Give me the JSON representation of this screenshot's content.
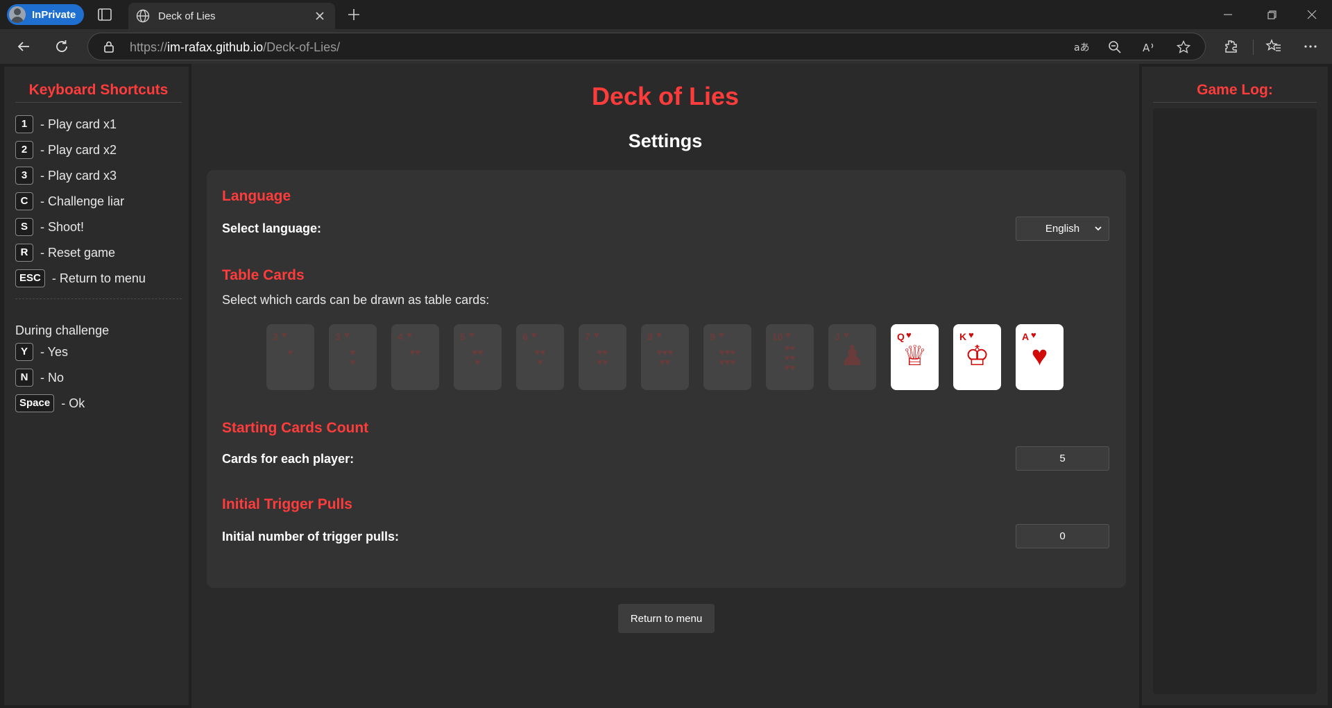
{
  "browser": {
    "profile_label": "InPrivate",
    "tab_title": "Deck of Lies",
    "url_prefix": "https://",
    "url_host": "im-rafax.github.io",
    "url_path": "/Deck-of-Lies/"
  },
  "shortcuts": {
    "title": "Keyboard Shortcuts",
    "items": [
      {
        "key": "1",
        "label": "- Play card x1"
      },
      {
        "key": "2",
        "label": "- Play card x2"
      },
      {
        "key": "3",
        "label": "- Play card x3"
      },
      {
        "key": "C",
        "label": "- Challenge liar"
      },
      {
        "key": "S",
        "label": "- Shoot!"
      },
      {
        "key": "R",
        "label": "- Reset game"
      },
      {
        "key": "ESC",
        "label": "- Return to menu"
      }
    ],
    "during_label": "During challenge",
    "challenge_items": [
      {
        "key": "Y",
        "label": "- Yes"
      },
      {
        "key": "N",
        "label": "- No"
      },
      {
        "key": "Space",
        "label": "- Ok"
      }
    ]
  },
  "main": {
    "game_title": "Deck of Lies",
    "settings_title": "Settings",
    "language": {
      "section": "Language",
      "label": "Select language:",
      "selected": "English"
    },
    "table_cards": {
      "section": "Table Cards",
      "description": "Select which cards can be drawn as table cards:",
      "cards": [
        {
          "rank": "2",
          "suit": "♥",
          "pips": "♥",
          "selected": false
        },
        {
          "rank": "3",
          "suit": "♥",
          "pips": "♥\n♥",
          "selected": false
        },
        {
          "rank": "4",
          "suit": "♥",
          "pips": "♥♥",
          "selected": false
        },
        {
          "rank": "5",
          "suit": "♥",
          "pips": "♥♥\n♥",
          "selected": false
        },
        {
          "rank": "6",
          "suit": "♥",
          "pips": "♥♥\n♥",
          "selected": false
        },
        {
          "rank": "7",
          "suit": "♥",
          "pips": "♥♥\n♥♥",
          "selected": false
        },
        {
          "rank": "8",
          "suit": "♥",
          "pips": "♥♥♥\n♥♥",
          "selected": false
        },
        {
          "rank": "9",
          "suit": "♥",
          "pips": "♥♥♥\n♥♥♥",
          "selected": false
        },
        {
          "rank": "10",
          "suit": "♥",
          "pips": "♥♥\n♥♥\n♥♥",
          "selected": false
        },
        {
          "rank": "J",
          "suit": "♥",
          "pips": "♟",
          "selected": false
        },
        {
          "rank": "Q",
          "suit": "♥",
          "pips": "♕",
          "selected": true
        },
        {
          "rank": "K",
          "suit": "♥",
          "pips": "♔",
          "selected": true
        },
        {
          "rank": "A",
          "suit": "♥",
          "pips": "♥",
          "selected": true
        }
      ]
    },
    "starting_cards": {
      "section": "Starting Cards Count",
      "label": "Cards for each player:",
      "value": "5"
    },
    "trigger_pulls": {
      "section": "Initial Trigger Pulls",
      "label": "Initial number of trigger pulls:",
      "value": "0"
    },
    "return_button": "Return to menu"
  },
  "game_log": {
    "title": "Game Log:"
  }
}
